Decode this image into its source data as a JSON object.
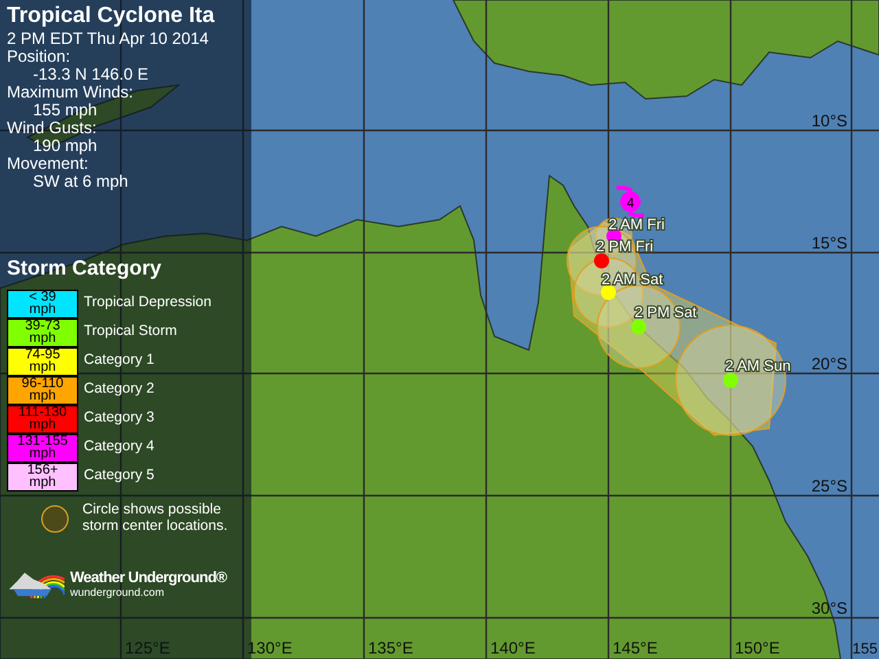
{
  "storm": {
    "title": "Tropical Cyclone Ita",
    "details": [
      {
        "kind": "line",
        "text": "2 PM EDT Thu Apr 10 2014"
      },
      {
        "kind": "line",
        "text": "Position:"
      },
      {
        "kind": "value",
        "text": "-13.3 N 146.0 E"
      },
      {
        "kind": "line",
        "text": "Maximum Winds:"
      },
      {
        "kind": "value",
        "text": "155 mph"
      },
      {
        "kind": "line",
        "text": "Wind Gusts:"
      },
      {
        "kind": "value",
        "text": "190 mph"
      },
      {
        "kind": "line",
        "text": "Movement:"
      },
      {
        "kind": "value",
        "text": "SW at 6 mph"
      }
    ]
  },
  "legend": {
    "title": "Storm Category",
    "categories": [
      {
        "range": [
          "< 39",
          "mph"
        ],
        "label": "Tropical Depression",
        "color": "#00e5ff"
      },
      {
        "range": [
          "39-73",
          "mph"
        ],
        "label": "Tropical Storm",
        "color": "#80ff00"
      },
      {
        "range": [
          "74-95",
          "mph"
        ],
        "label": "Category 1",
        "color": "#ffff00"
      },
      {
        "range": [
          "96-110",
          "mph"
        ],
        "label": "Category 2",
        "color": "#ffa500"
      },
      {
        "range": [
          "111-130",
          "mph"
        ],
        "label": "Category 3",
        "color": "#ff0000"
      },
      {
        "range": [
          "131-155",
          "mph"
        ],
        "label": "Category 4",
        "color": "#ff00ff"
      },
      {
        "range": [
          "156+",
          "mph"
        ],
        "label": "Category 5",
        "color": "#ffc0ff"
      }
    ],
    "circle_note": "Circle shows possible storm center locations."
  },
  "logo": {
    "name": "Weather Underground®",
    "url": "wunderground.com"
  },
  "map": {
    "current": {
      "label": "4",
      "color": "#ff00ff"
    },
    "forecast": [
      {
        "label": "2 AM Fri",
        "color": "#ff00ff"
      },
      {
        "label": "2 PM Fri",
        "color": "#ff0000"
      },
      {
        "label": "2 AM Sat",
        "color": "#ffff00"
      },
      {
        "label": "2 PM Sat",
        "color": "#80ff00"
      },
      {
        "label": "2 AM Sun",
        "color": "#80ff00"
      }
    ],
    "lat_labels": [
      "10°S",
      "15°S",
      "20°S",
      "25°S",
      "30°S"
    ],
    "lon_labels": [
      "125°E",
      "130°E",
      "135°E",
      "140°E",
      "145°E",
      "150°E",
      "155"
    ]
  }
}
